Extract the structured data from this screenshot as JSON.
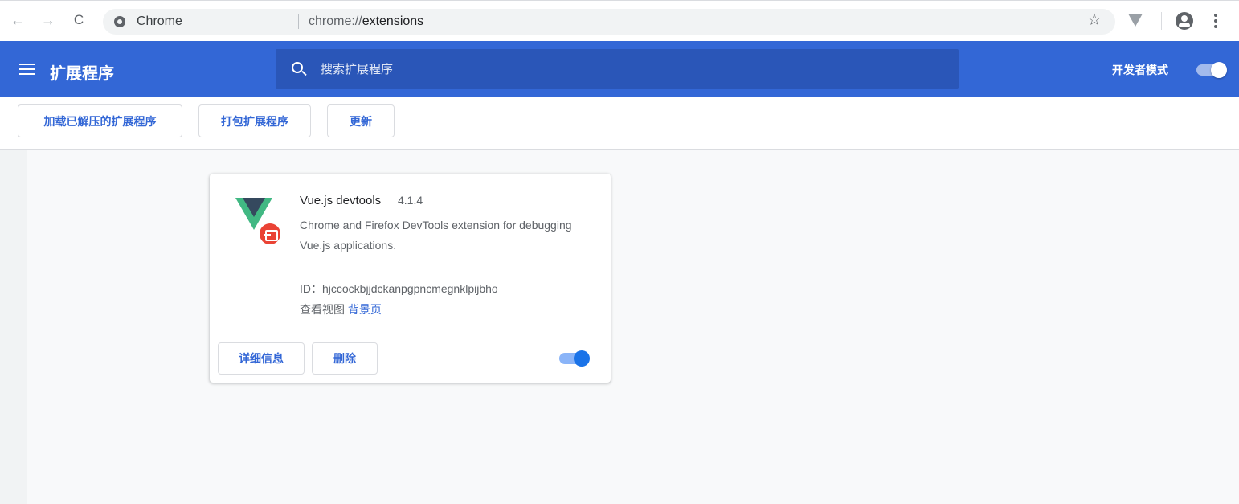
{
  "browser": {
    "omnibox": {
      "site_chip": "Chrome",
      "url_scheme": "chrome://",
      "url_path": "extensions"
    },
    "nav": {
      "back_glyph": "←",
      "forward_glyph": "→",
      "reload_glyph": "C"
    },
    "star_glyph": "☆"
  },
  "header": {
    "title": "扩展程序",
    "search_placeholder": "搜索扩展程序",
    "dev_mode_label": "开发者模式",
    "dev_mode_on": true,
    "accent_color": "#3367d6"
  },
  "toolbar": {
    "load_unpacked_label": "加载已解压的扩展程序",
    "pack_label": "打包扩展程序",
    "update_label": "更新"
  },
  "extension": {
    "name": "Vue.js devtools",
    "version": "4.1.4",
    "description": "Chrome and Firefox DevTools extension for debugging Vue.js applications.",
    "id_text": "ID：hjccockbjjdckanpgpncmegnklpijbho",
    "views_label": "查看视图",
    "views_link": "背景页",
    "details_label": "详细信息",
    "remove_label": "删除",
    "enabled": true,
    "icon": "vue-logo-icon",
    "badge_icon": "unpacked-badge-icon"
  }
}
